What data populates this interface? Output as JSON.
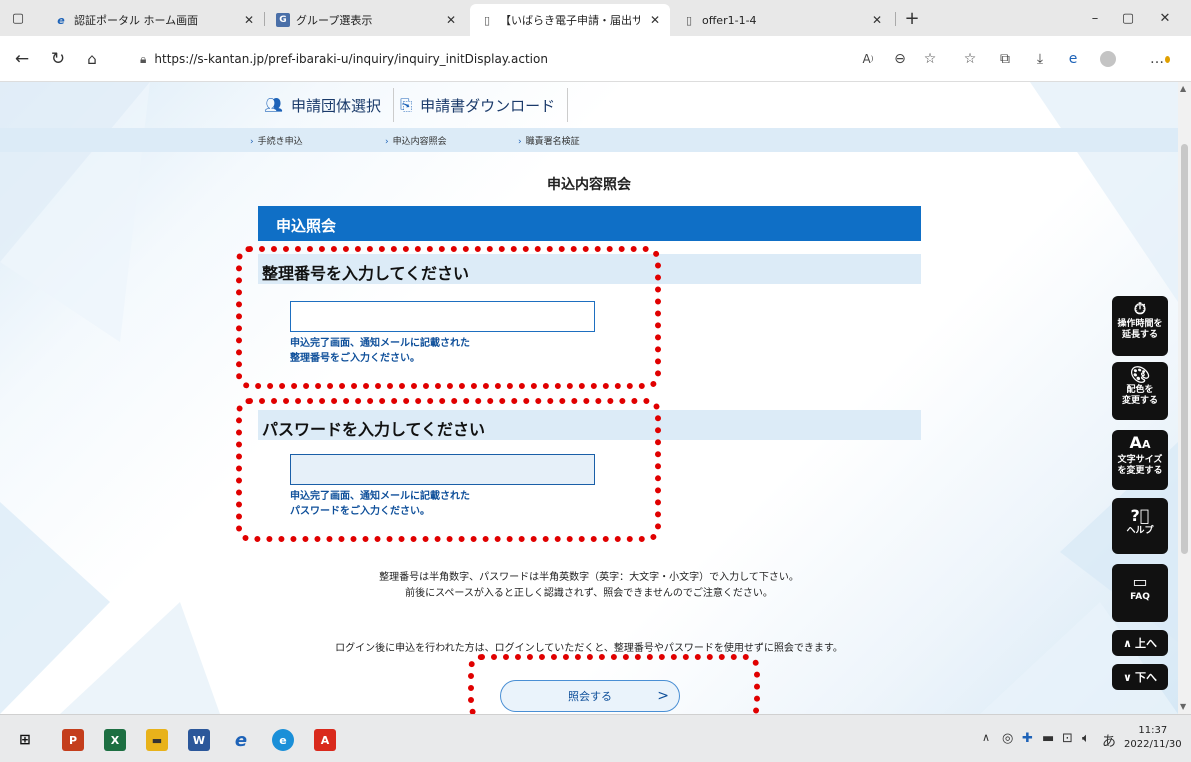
{
  "browser": {
    "tabs": [
      {
        "title": "認証ポータル ホーム画面",
        "active": false
      },
      {
        "title": "グループ選表示",
        "active": false
      },
      {
        "title": "【いばらき電子申請・届出サービス】申",
        "active": true
      },
      {
        "title": "offer1-1-4",
        "active": false
      }
    ],
    "new_tab": "+",
    "url": "https://s-kantan.jp/pref-ibaraki-u/inquiry/inquiry_initDisplay.action",
    "read_aloud": "A",
    "colors": {
      "tab_bar": "#e8e8e8",
      "active_tab": "#ffffff"
    }
  },
  "site": {
    "top_nav": [
      {
        "label": "申請団体選択",
        "icon": "group-icon"
      },
      {
        "label": "申請書ダウンロード",
        "icon": "download-doc-icon"
      }
    ],
    "sub_nav": [
      "手続き申込",
      "申込内容照会",
      "職責署名検証"
    ],
    "page_title": "申込内容照会",
    "panel_title": "申込照会",
    "reference_section": {
      "heading": "整理番号を入力してください",
      "value": "",
      "hint_line1": "申込完了画面、通知メールに記載された",
      "hint_line2": "整理番号をご入力ください。"
    },
    "password_section": {
      "heading": "パスワードを入力してください",
      "value": "",
      "hint_line1": "申込完了画面、通知メールに記載された",
      "hint_line2": "パスワードをご入力ください。"
    },
    "note_line1": "整理番号は半角数字、パスワードは半角英数字（英字：大文字・小文字）で入力して下さい。",
    "note_line2": "前後にスペースが入ると正しく認識されず、照会できませんのでご注意ください。",
    "login_note": "ログイン後に申込を行われた方は、ログインしていただくと、整理番号やパスワードを使用せずに照会できます。",
    "submit_label": "照会する",
    "colors": {
      "primary": "#0f6fc6",
      "section_bg": "#dcebf7",
      "hint_text": "#0e4f9a",
      "highlight": "#e00000"
    }
  },
  "side_tools": [
    {
      "line1": "操作時間を",
      "line2": "延長する",
      "icon": "stopwatch-icon"
    },
    {
      "line1": "配色を",
      "line2": "変更する",
      "icon": "palette-icon"
    },
    {
      "line1": "文字サイズ",
      "line2": "を変更する",
      "icon": "font-size-icon"
    },
    {
      "line1": "ヘルプ",
      "line2": "",
      "icon": "help-icon"
    },
    {
      "line1": "FAQ",
      "line2": "",
      "icon": "faq-icon"
    },
    {
      "line1": "上へ",
      "line2": "",
      "icon": "up-icon"
    },
    {
      "line1": "下へ",
      "line2": "",
      "icon": "down-icon"
    }
  ],
  "taskbar": {
    "time": "11:37",
    "date": "2022/11/30",
    "ime": "あ"
  }
}
